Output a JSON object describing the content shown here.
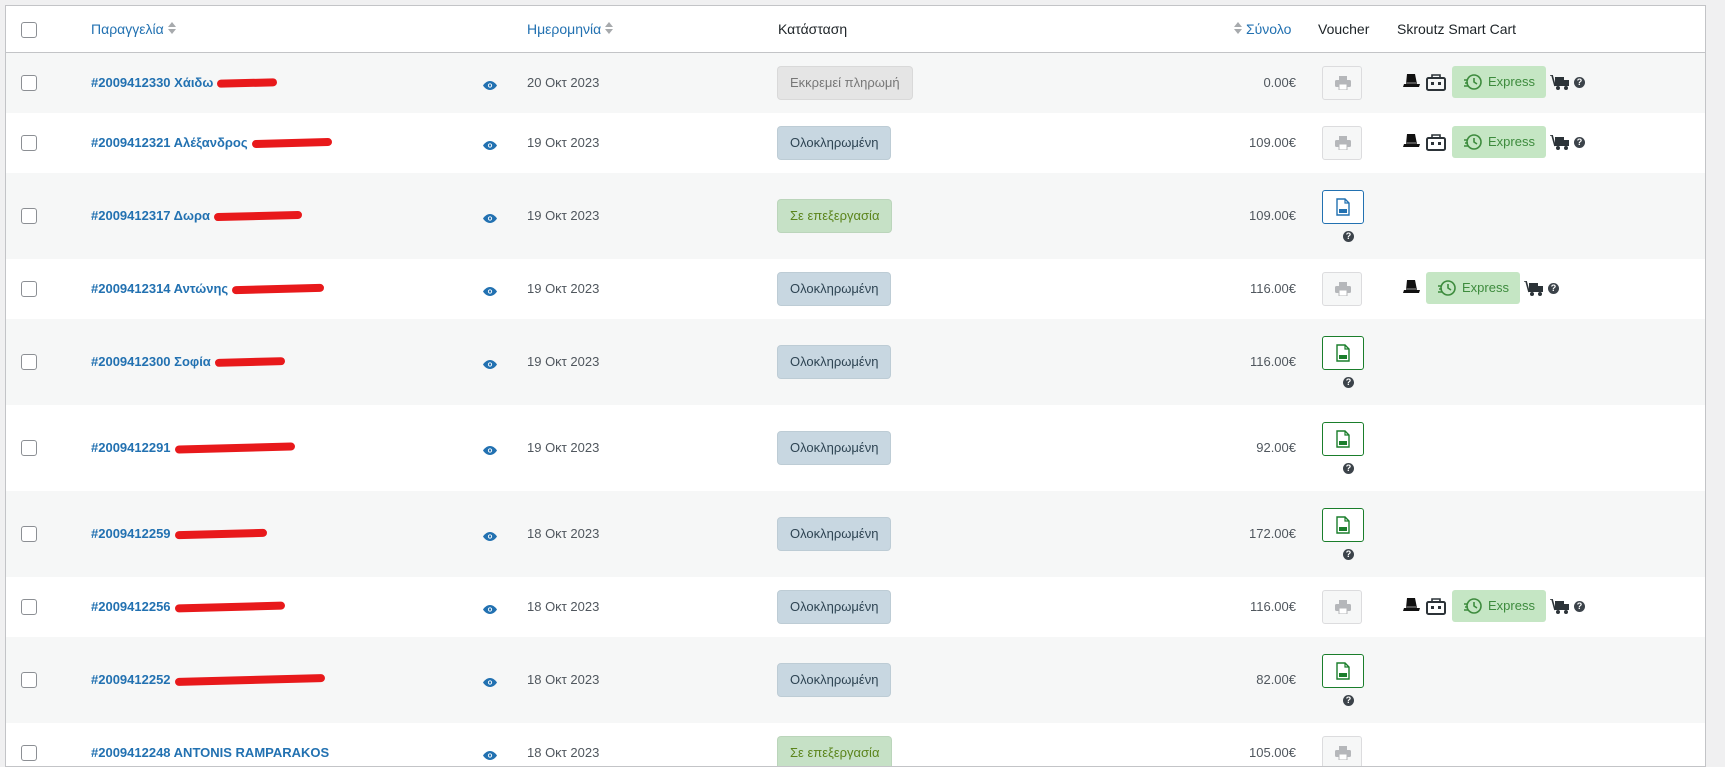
{
  "columns": {
    "order": "Παραγγελία",
    "date": "Ημερομηνία",
    "status": "Κατάσταση",
    "total": "Σύνολο",
    "voucher": "Voucher",
    "skroutz": "Skroutz Smart Cart"
  },
  "express_label": "Express",
  "orders": [
    {
      "number": "#2009412330",
      "name": "Χάιδω",
      "date": "20 Οκτ 2023",
      "status": "Εκκρεμεί πληρωμή",
      "status_type": "pending",
      "total": "0.00€",
      "voucher": "print",
      "skroutz": "full"
    },
    {
      "number": "#2009412321",
      "name": "Αλέξανδρος",
      "date": "19 Οκτ 2023",
      "status": "Ολοκληρωμένη",
      "status_type": "completed",
      "total": "109.00€",
      "voucher": "print",
      "skroutz": "full"
    },
    {
      "number": "#2009412317",
      "name": "Δωρα",
      "date": "19 Οκτ 2023",
      "status": "Σε επεξεργασία",
      "status_type": "processing",
      "total": "109.00€",
      "voucher": "pdf-blue",
      "skroutz": "none"
    },
    {
      "number": "#2009412314",
      "name": "Αντώνης",
      "date": "19 Οκτ 2023",
      "status": "Ολοκληρωμένη",
      "status_type": "completed",
      "total": "116.00€",
      "voucher": "print",
      "skroutz": "short"
    },
    {
      "number": "#2009412300",
      "name": "Σοφία",
      "date": "19 Οκτ 2023",
      "status": "Ολοκληρωμένη",
      "status_type": "completed",
      "total": "116.00€",
      "voucher": "pdf-green",
      "skroutz": "none"
    },
    {
      "number": "#2009412291",
      "name": "",
      "date": "19 Οκτ 2023",
      "status": "Ολοκληρωμένη",
      "status_type": "completed",
      "total": "92.00€",
      "voucher": "pdf-green",
      "skroutz": "none"
    },
    {
      "number": "#2009412259",
      "name": "",
      "date": "18 Οκτ 2023",
      "status": "Ολοκληρωμένη",
      "status_type": "completed",
      "total": "172.00€",
      "voucher": "pdf-green",
      "skroutz": "none"
    },
    {
      "number": "#2009412256",
      "name": "",
      "date": "18 Οκτ 2023",
      "status": "Ολοκληρωμένη",
      "status_type": "completed",
      "total": "116.00€",
      "voucher": "print",
      "skroutz": "full"
    },
    {
      "number": "#2009412252",
      "name": "",
      "date": "18 Οκτ 2023",
      "status": "Ολοκληρωμένη",
      "status_type": "completed",
      "total": "82.00€",
      "voucher": "pdf-green",
      "skroutz": "none"
    },
    {
      "number": "#2009412248",
      "name": "ANTONIS RAMPARAKOS",
      "date": "18 Οκτ 2023",
      "status": "Σε επεξεργασία",
      "status_type": "processing",
      "total": "105.00€",
      "voucher": "print",
      "skroutz": "none"
    }
  ]
}
